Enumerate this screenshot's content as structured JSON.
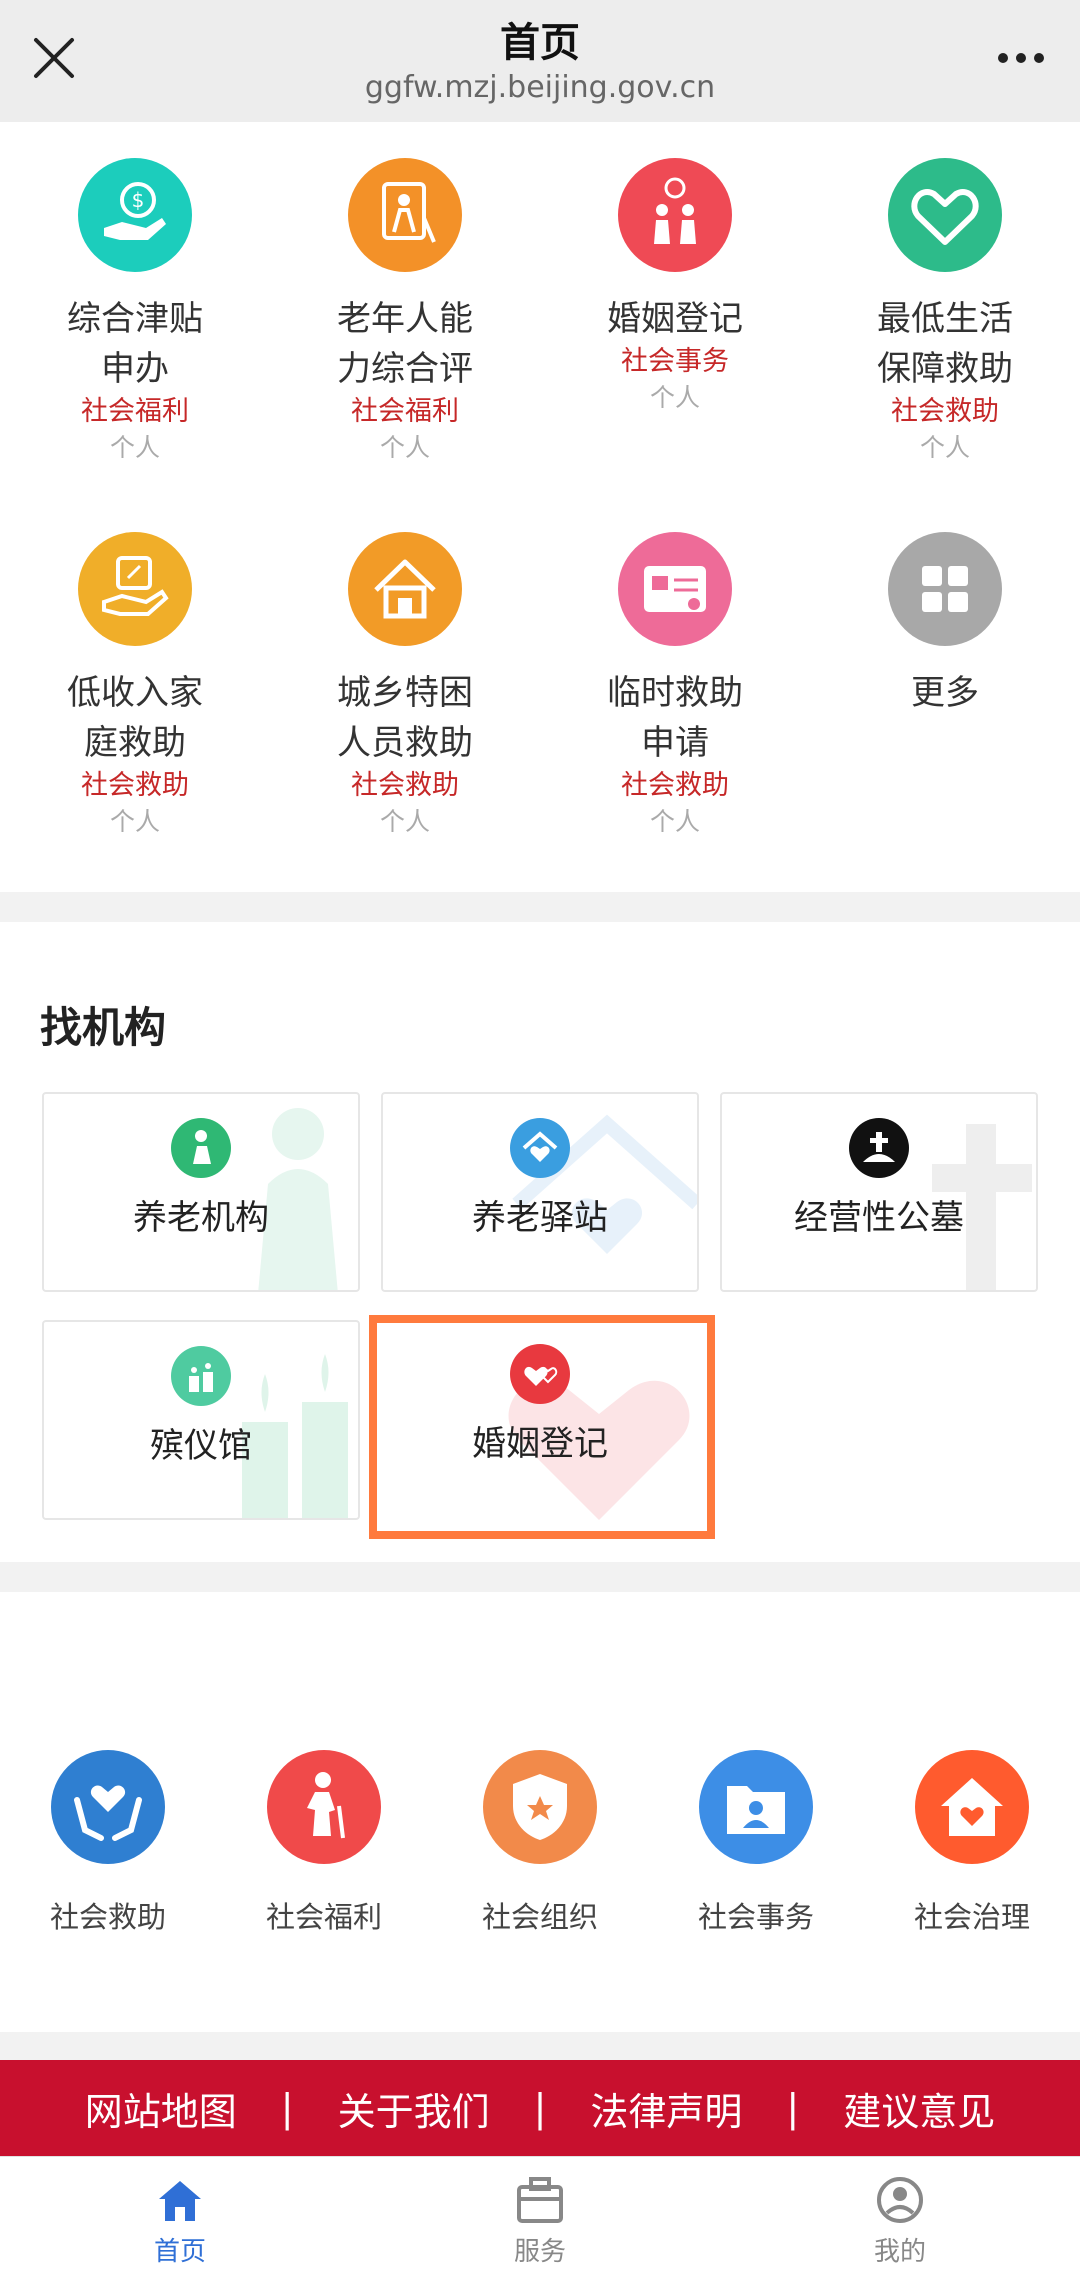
{
  "header": {
    "title": "首页",
    "url": "ggfw.mzj.beijing.gov.cn"
  },
  "services": [
    {
      "name": "综合津贴申办",
      "category": "社会福利",
      "audience": "个人",
      "color": "#1ccdbc",
      "icon": "money-hand-icon"
    },
    {
      "name": "老年人能力综合评",
      "category": "社会福利",
      "audience": "个人",
      "color": "#f39128",
      "icon": "elderly-assessment-icon"
    },
    {
      "name": "婚姻登记",
      "category": "社会事务",
      "audience": "个人",
      "color": "#ef4a55",
      "icon": "couple-icon"
    },
    {
      "name": "最低生活保障救助",
      "category": "社会救助",
      "audience": "个人",
      "color": "#2dbb8a",
      "icon": "heart-hand-icon"
    },
    {
      "name": "低收入家庭救助",
      "category": "社会救助",
      "audience": "个人",
      "color": "#f0ae29",
      "icon": "form-hand-icon"
    },
    {
      "name": "城乡特困人员救助",
      "category": "社会救助",
      "audience": "个人",
      "color": "#f29b27",
      "icon": "house-icon"
    },
    {
      "name": "临时救助申请",
      "category": "社会救助",
      "audience": "个人",
      "color": "#ee6b98",
      "icon": "id-card-icon"
    },
    {
      "name": "更多",
      "category": "",
      "audience": "",
      "color": "#a8a8a8",
      "icon": "grid-icon"
    }
  ],
  "find": {
    "title": "找机构",
    "institutions": [
      {
        "label": "养老机构",
        "color": "#2fb874",
        "icon": "elderly-icon"
      },
      {
        "label": "养老驿站",
        "color": "#3a9ee0",
        "icon": "house-heart-icon"
      },
      {
        "label": "经营性公墓",
        "color": "#111111",
        "icon": "cemetery-icon"
      },
      {
        "label": "殡仪馆",
        "color": "#4fcba0",
        "icon": "candle-icon"
      },
      {
        "label": "婚姻登记",
        "color": "#e8393f",
        "icon": "hearts-icon"
      }
    ]
  },
  "categories": [
    {
      "label": "社会救助",
      "color": "#2f7fd1",
      "icon": "heart-hands-icon"
    },
    {
      "label": "社会福利",
      "color": "#f04a4a",
      "icon": "elderly-cane-icon"
    },
    {
      "label": "社会组织",
      "color": "#f28a4a",
      "icon": "shield-star-icon"
    },
    {
      "label": "社会事务",
      "color": "#3d8ee6",
      "icon": "folder-person-icon"
    },
    {
      "label": "社会治理",
      "color": "#ff5b2e",
      "icon": "home-heart-icon"
    }
  ],
  "footer_links": [
    "网站地图",
    "关于我们",
    "法律声明",
    "建议意见"
  ],
  "footer_separator": "|",
  "nav": [
    {
      "label": "首页",
      "icon": "home-icon",
      "active": true
    },
    {
      "label": "服务",
      "icon": "briefcase-icon",
      "active": false
    },
    {
      "label": "我的",
      "icon": "user-icon",
      "active": false
    }
  ],
  "colors": {
    "accent_red": "#c8102e",
    "nav_active": "#2f6fd6",
    "highlight": "#ff7a3d"
  }
}
